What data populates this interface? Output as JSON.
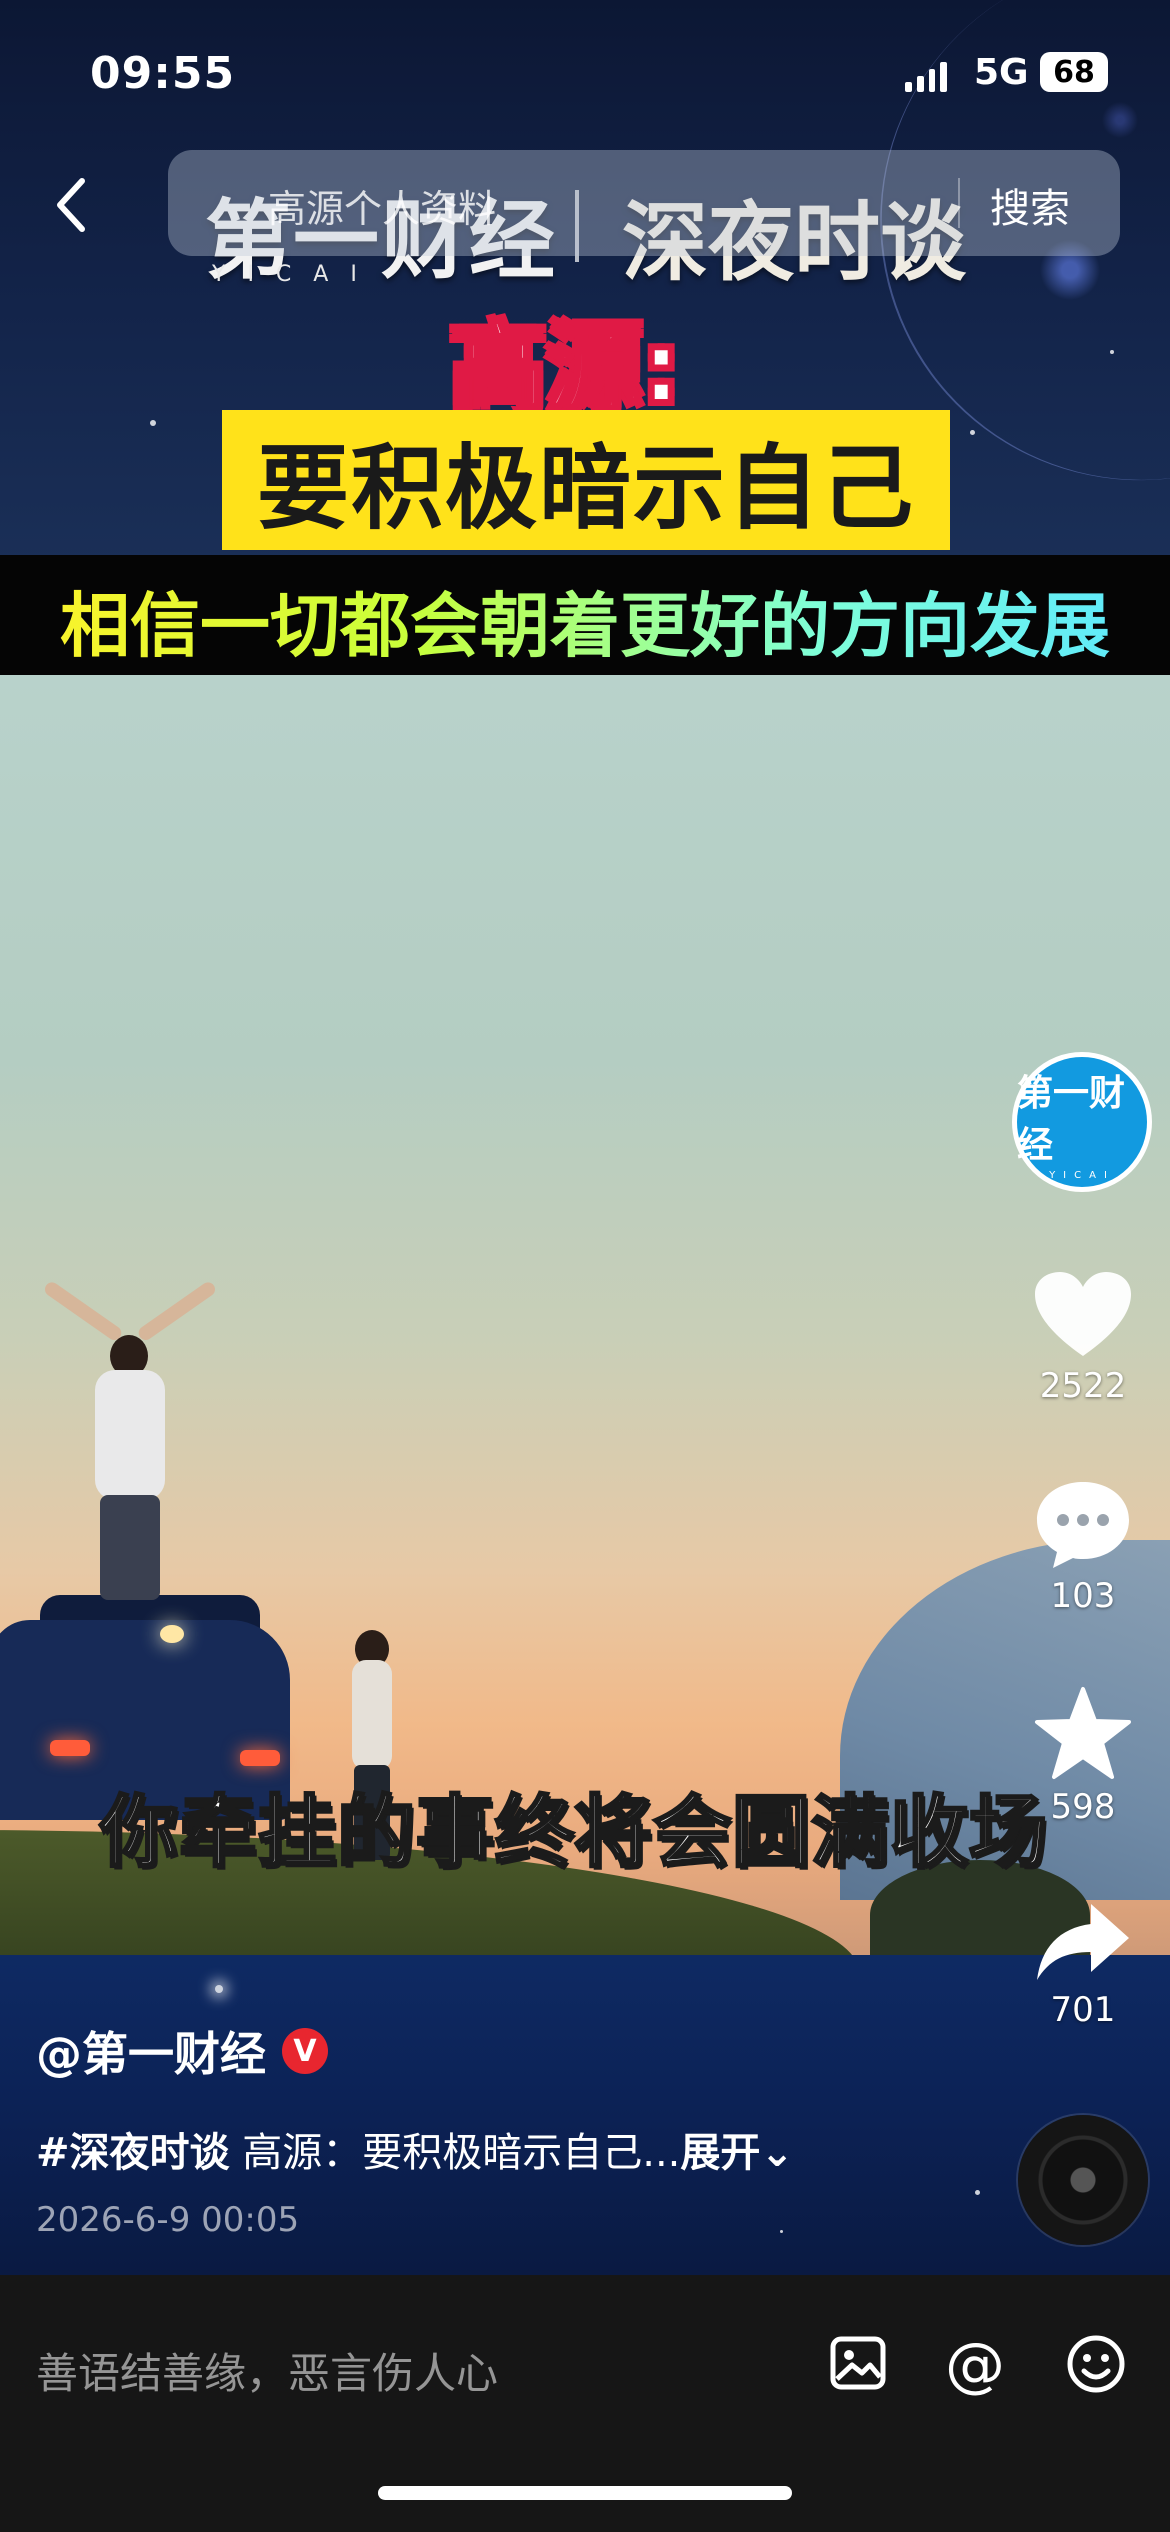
{
  "status_bar": {
    "time": "09:55",
    "network": "5G",
    "battery": "68"
  },
  "nav": {
    "search_placeholder": "高源个人资料",
    "search_button": "搜索"
  },
  "video": {
    "brand_logo": "第一财经",
    "brand_logo_sub": "YICAI",
    "program_name": "深夜时谈",
    "speaker": "高源:",
    "headline": "要积极暗示自己",
    "subheadline": "相信一切都会朝着更好的方向发展",
    "caption": "你牵挂的事终将会圆满收场"
  },
  "creator": {
    "avatar_text": "第一财经",
    "avatar_sub": "YICAI"
  },
  "actions": {
    "likes": "2522",
    "comments": "103",
    "favorites": "598",
    "shares": "701"
  },
  "post": {
    "author": "@第一财经",
    "verified_badge": "V",
    "tag": "#深夜时谈",
    "description": " 高源：要积极暗示自己...",
    "expand": "展开⌄",
    "date": "2026-6-9 00:05"
  },
  "comment_bar": {
    "placeholder": "善语结善缘，恶言伤人心",
    "at_symbol": "@"
  },
  "icons": {
    "back": "chevron-left-icon",
    "like": "heart-icon",
    "comment": "chat-bubble-icon",
    "favorite": "star-icon",
    "share": "share-arrow-icon",
    "image": "image-icon",
    "at": "at-icon",
    "emoji": "smiley-icon"
  }
}
